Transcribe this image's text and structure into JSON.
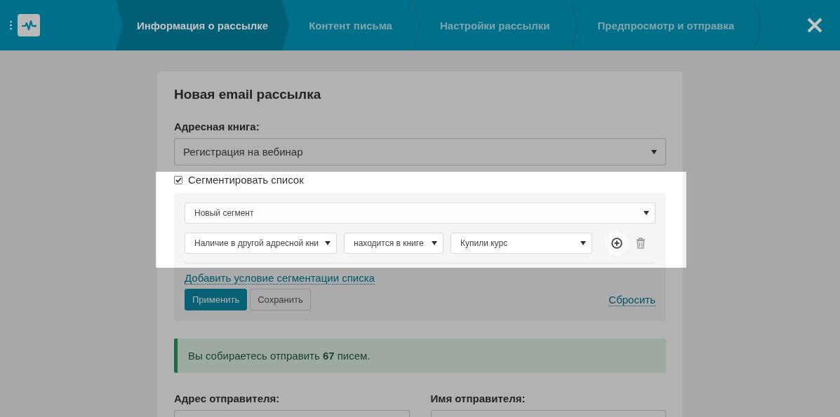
{
  "header": {
    "steps": [
      {
        "label": "Информация о рассылке",
        "selected": true
      },
      {
        "label": "Контент письма",
        "selected": false
      },
      {
        "label": "Настройки рассылки",
        "selected": false
      },
      {
        "label": "Предпросмотр и отправка",
        "selected": false
      }
    ]
  },
  "form": {
    "title": "Новая email рассылка",
    "address_book": {
      "label": "Адресная книга:",
      "value": "Регистрация на вебинар"
    },
    "segment": {
      "label": "Сегментировать список",
      "checked": true,
      "segment_select": "Новый сегмент",
      "conditions": [
        {
          "field": "Наличие в другой адресной кни",
          "operator": "находится в книге",
          "value": "Купили курс"
        }
      ],
      "add_condition_link": "Добавить условие сегментации списка",
      "buttons": [
        {
          "label": "Применить",
          "kind": "primary"
        },
        {
          "label": "Сохранить",
          "kind": "default"
        }
      ],
      "reset_link": "Сбросить"
    },
    "alert": "Вы собираетесь отправить **67** писем.",
    "sender_address": {
      "label": "Адрес отправителя:"
    },
    "sender_name": {
      "label": "Имя отправителя:"
    }
  }
}
